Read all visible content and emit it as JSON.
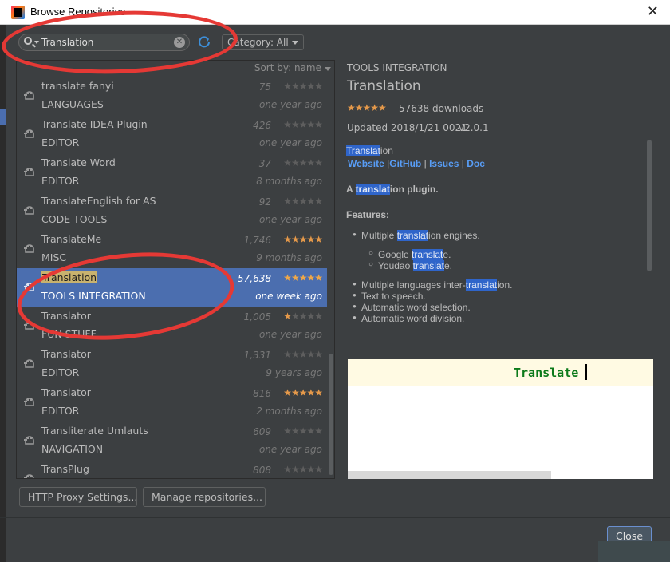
{
  "window": {
    "title": "Browse Repositories",
    "close_glyph": "✕"
  },
  "toolbar": {
    "search_value": "Translation",
    "search_clear_glyph": "✕",
    "category_label": "Category: All"
  },
  "list": {
    "sort_label": "Sort by: name",
    "items": [
      {
        "name": "translate fanyi",
        "category": "LANGUAGES",
        "downloads": "75",
        "rating": 0,
        "updated": "one year ago"
      },
      {
        "name": "Translate IDEA Plugin",
        "category": "EDITOR",
        "downloads": "426",
        "rating": 0,
        "updated": "one year ago"
      },
      {
        "name": "Translate Word",
        "category": "EDITOR",
        "downloads": "37",
        "rating": 0,
        "updated": "8 months ago"
      },
      {
        "name": "TranslateEnglish for AS",
        "category": "CODE TOOLS",
        "downloads": "92",
        "rating": 0,
        "updated": "one year ago"
      },
      {
        "name": "TranslateMe",
        "category": "MISC",
        "downloads": "1,746",
        "rating": 5,
        "updated": "9 months ago"
      },
      {
        "name": "Translation",
        "category": "TOOLS INTEGRATION",
        "downloads": "57,638",
        "rating": 5,
        "updated": "one week ago",
        "selected": true
      },
      {
        "name": "Translator",
        "category": "FUN STUFF",
        "downloads": "1,005",
        "rating": 1,
        "updated": "one year ago"
      },
      {
        "name": "Translator",
        "category": "EDITOR",
        "downloads": "1,331",
        "rating": 0,
        "updated": "9 years ago"
      },
      {
        "name": "Translator",
        "category": "EDITOR",
        "downloads": "816",
        "rating": 5,
        "updated": "2 months ago"
      },
      {
        "name": "Transliterate Umlauts",
        "category": "NAVIGATION",
        "downloads": "609",
        "rating": 0,
        "updated": "one year ago"
      },
      {
        "name": "TransPlug",
        "category": "",
        "downloads": "808",
        "rating": 0,
        "updated": ""
      }
    ]
  },
  "detail": {
    "category": "TOOLS INTEGRATION",
    "title": "Translation",
    "stars": "★★★★★",
    "downloads": "57638 downloads",
    "updated": "Updated 2018/1/21 0021",
    "version": "v2.0.1",
    "desc_title_hl": "Translat",
    "desc_title_rest": "ion",
    "links": {
      "website": "Website",
      "github": "GitHub",
      "issues": "Issues",
      "doc": "Doc",
      "sep": "|"
    },
    "tagline_a": "A ",
    "tagline_hl": "translat",
    "tagline_rest": "ion plugin.",
    "features_label": "Features:",
    "f1_pre": "Multiple ",
    "f1_hl": "translat",
    "f1_post": "ion engines.",
    "s1_pre": "Google ",
    "s1_hl": "translat",
    "s1_post": "e.",
    "s2_pre": "Youdao ",
    "s2_hl": "translat",
    "s2_post": "e.",
    "f2_pre": "Multiple languages inter-",
    "f2_hl": "translat",
    "f2_post": "ion.",
    "f3": "Text to speech.",
    "f4": "Automatic word selection.",
    "f5": "Automatic word division.",
    "preview_text": "Translate"
  },
  "footer": {
    "proxy_label": "HTTP Proxy Settings...",
    "manage_label": "Manage repositories...",
    "close_label": "Close"
  },
  "colors": {
    "accent": "#4b6eaf",
    "star": "#e5994a",
    "annotation": "#e53935",
    "link": "#589df6"
  }
}
